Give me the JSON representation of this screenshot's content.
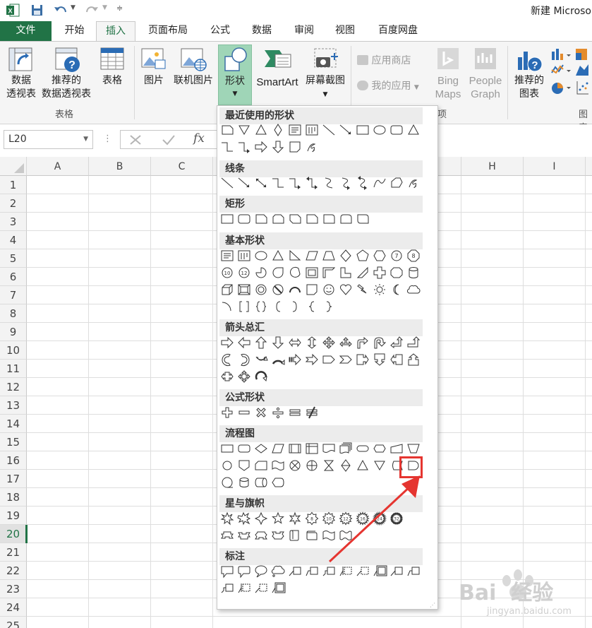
{
  "title_bar": {
    "title": "新建 Microso"
  },
  "tabs": [
    {
      "label": "文件"
    },
    {
      "label": "开始"
    },
    {
      "label": "插入"
    },
    {
      "label": "页面布局"
    },
    {
      "label": "公式"
    },
    {
      "label": "数据"
    },
    {
      "label": "审阅"
    },
    {
      "label": "视图"
    },
    {
      "label": "百度网盘"
    }
  ],
  "ribbon": {
    "pivot_table": "数据\n透视表",
    "recommended_pivot": "推荐的\n数据透视表",
    "table": "表格",
    "group_tables": "表格",
    "picture": "图片",
    "online_picture": "联机图片",
    "shapes": "形状",
    "smartart": "SmartArt",
    "screenshot": "屏幕截图",
    "app_store": "应用商店",
    "my_apps": "我的应用",
    "bing_maps": "Bing\nMaps",
    "people_graph": "People\nGraph",
    "group_apps": "项",
    "recommended_charts": "推荐的\n图表",
    "group_charts": "图表"
  },
  "formula_bar": {
    "name_box": "L20",
    "fx": "fx"
  },
  "columns": [
    "A",
    "B",
    "C",
    "H",
    "I"
  ],
  "rows": [
    "1",
    "2",
    "3",
    "4",
    "5",
    "6",
    "7",
    "8",
    "9",
    "10",
    "11",
    "12",
    "13",
    "14",
    "15",
    "16",
    "17",
    "18",
    "19",
    "20",
    "21",
    "22",
    "23",
    "24",
    "25"
  ],
  "gallery": {
    "sections": [
      "最近使用的形状",
      "线条",
      "矩形",
      "基本形状",
      "箭头总汇",
      "公式形状",
      "流程图",
      "星与旗帜",
      "标注"
    ],
    "highlight_color": "#e53530"
  },
  "watermark": {
    "text_top": "Bai  经验",
    "text_bottom": "jingyan.baidu.com"
  }
}
